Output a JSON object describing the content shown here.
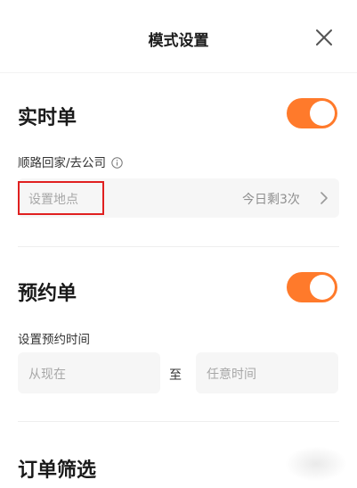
{
  "header": {
    "title": "模式设置",
    "close_icon": "close-icon"
  },
  "realtime": {
    "title": "实时单",
    "toggle_on": true,
    "route_label": "顺路回家/去公司",
    "info_icon": "info-icon",
    "location_placeholder": "设置地点",
    "remaining": "今日剩3次",
    "chevron_icon": "chevron-right-icon"
  },
  "reservation": {
    "title": "预约单",
    "toggle_on": true,
    "time_label": "设置预约时间",
    "from_placeholder": "从现在",
    "to_label": "至",
    "to_placeholder": "任意时间"
  },
  "filter": {
    "title": "订单筛选"
  },
  "colors": {
    "accent": "#ff7a2b",
    "highlight_border": "#e02020",
    "field_bg": "#f6f6f6"
  }
}
